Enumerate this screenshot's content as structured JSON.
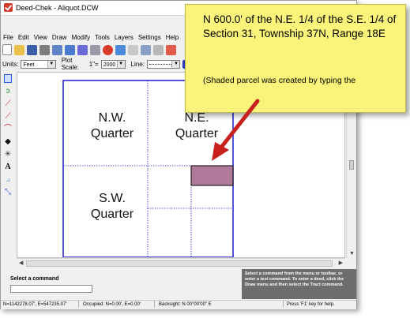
{
  "window": {
    "title": "Deed-Chek - Aliquot.DCW"
  },
  "menu": {
    "items": [
      "File",
      "Edit",
      "View",
      "Draw",
      "Modify",
      "Tools",
      "Layers",
      "Settings",
      "Help"
    ]
  },
  "toolbar2": {
    "units_label": "Units:",
    "units_value": "Feet",
    "plot_scale_label": "Plot Scale:",
    "plot_scale_prefix": "1\"=",
    "plot_scale_value": "2000",
    "line_label": "Line:"
  },
  "drawing": {
    "nw_label_1": "N.W.",
    "nw_label_2": "Quarter",
    "ne_label_1": "N.E.",
    "ne_label_2": "Quarter",
    "sw_label_1": "S.W.",
    "sw_label_2": "Quarter",
    "parcel_color": "#b07a9a",
    "line_color": "#1a1ad0"
  },
  "command": {
    "label": "Select a command",
    "help": "Select a command from the menu or toolbar, or enter a text command. To enter a deed, click the Draw menu and then select the Tract command."
  },
  "status": {
    "coords": "N=1142278.07', E=547235.07'",
    "occupied": "Occupied: N=0.00', E=0.00'",
    "backsight": "Backsight: N 00°00'00\" E",
    "help": "Press 'F1' key for help."
  },
  "callout": {
    "description": "N 600.0' of the N.E. 1/4 of the S.E. 1/4 of Section 31, Township 37N, Range 18E",
    "note": "(Shaded parcel was created by typing the",
    "bg_color": "#fbf47a",
    "arrow_color": "#c8201f"
  }
}
